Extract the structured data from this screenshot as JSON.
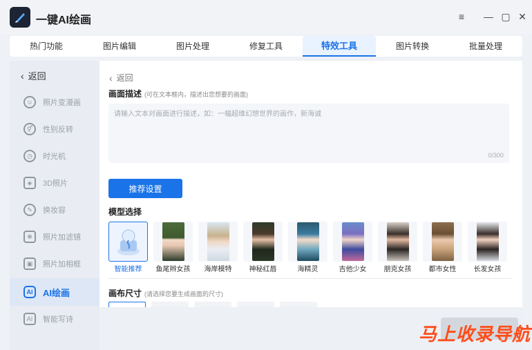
{
  "app": {
    "title": "一键AI绘画"
  },
  "window_controls": {
    "menu": "≡",
    "minimize": "—",
    "maximize": "▢",
    "close": "✕"
  },
  "tabs": [
    {
      "label": "热门功能",
      "active": false
    },
    {
      "label": "图片编辑",
      "active": false
    },
    {
      "label": "图片处理",
      "active": false
    },
    {
      "label": "修复工具",
      "active": false
    },
    {
      "label": "特效工具",
      "active": true
    },
    {
      "label": "图片转换",
      "active": false
    },
    {
      "label": "批量处理",
      "active": false
    }
  ],
  "sidebar": {
    "back_label": "返回",
    "items": [
      {
        "label": "照片变漫画",
        "icon": "cartoon-face-icon"
      },
      {
        "label": "性别反转",
        "icon": "gender-icon"
      },
      {
        "label": "时光机",
        "icon": "clock-icon"
      },
      {
        "label": "3D照片",
        "icon": "layers-icon"
      },
      {
        "label": "换妆容",
        "icon": "makeup-icon"
      },
      {
        "label": "照片加滤镜",
        "icon": "filter-icon"
      },
      {
        "label": "照片加相框",
        "icon": "frame-icon"
      },
      {
        "label": "AI绘画",
        "icon": "ai-icon",
        "active": true
      },
      {
        "label": "智能写诗",
        "icon": "ai-poem-icon"
      }
    ]
  },
  "main": {
    "back_label": "返回",
    "description": {
      "title": "画面描述",
      "hint": "(可在文本框内，描述出您想要的画面)",
      "placeholder": "请输入文本对画面进行描述，如：一幅超维幻想世界的画作，新海诚",
      "value": "",
      "counter": "0/300"
    },
    "recommend_button": "推荐设置",
    "model_section": {
      "title": "模型选择",
      "models": [
        {
          "label": "智能推荐",
          "selected": true
        },
        {
          "label": "鱼尾辫女孩"
        },
        {
          "label": "海岸模特"
        },
        {
          "label": "神秘红唇"
        },
        {
          "label": "海精灵"
        },
        {
          "label": "吉他少女"
        },
        {
          "label": "朋克女孩"
        },
        {
          "label": "都市女性"
        },
        {
          "label": "长发女孩"
        }
      ]
    },
    "canvas_section": {
      "title": "画布尺寸",
      "hint": "(请选择您要生成画面的尺寸)"
    }
  },
  "watermark": "马上收录导航",
  "colors": {
    "accent": "#1a73e8",
    "watermark": "#ff4d1a"
  }
}
